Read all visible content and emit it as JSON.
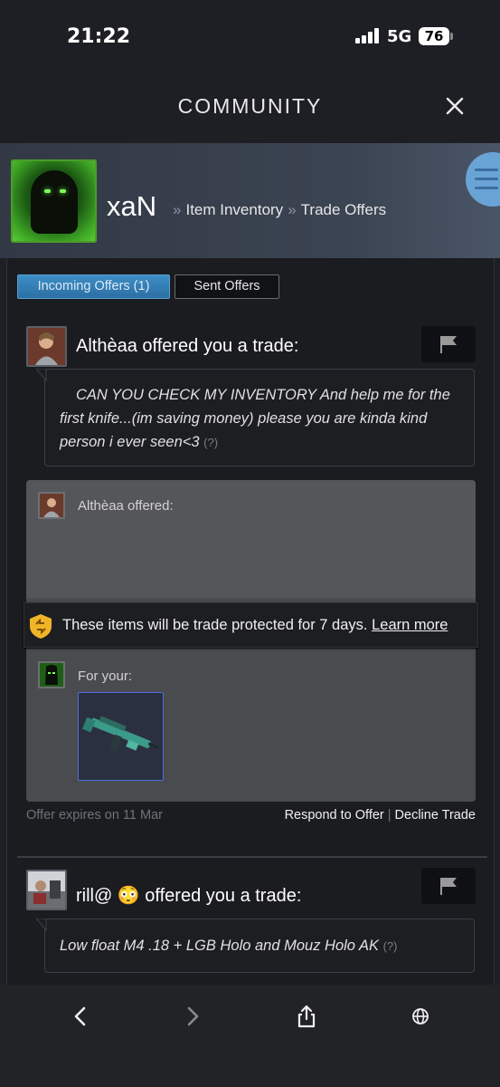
{
  "status_bar": {
    "time": "21:22",
    "network": "5G",
    "battery": "76"
  },
  "header": {
    "title": "COMMUNITY",
    "close_icon": "close-icon"
  },
  "profile": {
    "name": "xaN",
    "breadcrumb": [
      {
        "sep": "»",
        "label": "Item Inventory"
      },
      {
        "sep": "»",
        "label": "Trade Offers"
      }
    ]
  },
  "tabs": {
    "incoming": "Incoming Offers (1)",
    "sent": "Sent Offers"
  },
  "offers": [
    {
      "title": "Althèaa offered you a trade:",
      "message": "CAN YOU CHECK MY INVENTORY And help me for the first knife...(im saving money) please you are kinda kind person i ever seen<3",
      "help": "(?)",
      "offered_label": "Althèaa offered:",
      "protection_text": "These items will be trade protected for 7 days.",
      "learn_more": "Learn more",
      "for_your_label": "For your:",
      "expires": "Offer expires on 11 Mar",
      "respond": "Respond to Offer",
      "pipe": "|",
      "decline": "Decline Trade"
    },
    {
      "title": "rill@ 😳 offered you a trade:",
      "message": "Low float M4 .18 + LGB Holo and Mouz Holo AK",
      "help": "(?)"
    }
  ],
  "colors": {
    "accent_blue": "#3d8ec6",
    "item_border": "#4c6ddb",
    "shield_yellow": "#f0b429"
  },
  "toolbar": {
    "icons": [
      "back-icon",
      "forward-icon",
      "share-icon",
      "globe-icon"
    ]
  }
}
